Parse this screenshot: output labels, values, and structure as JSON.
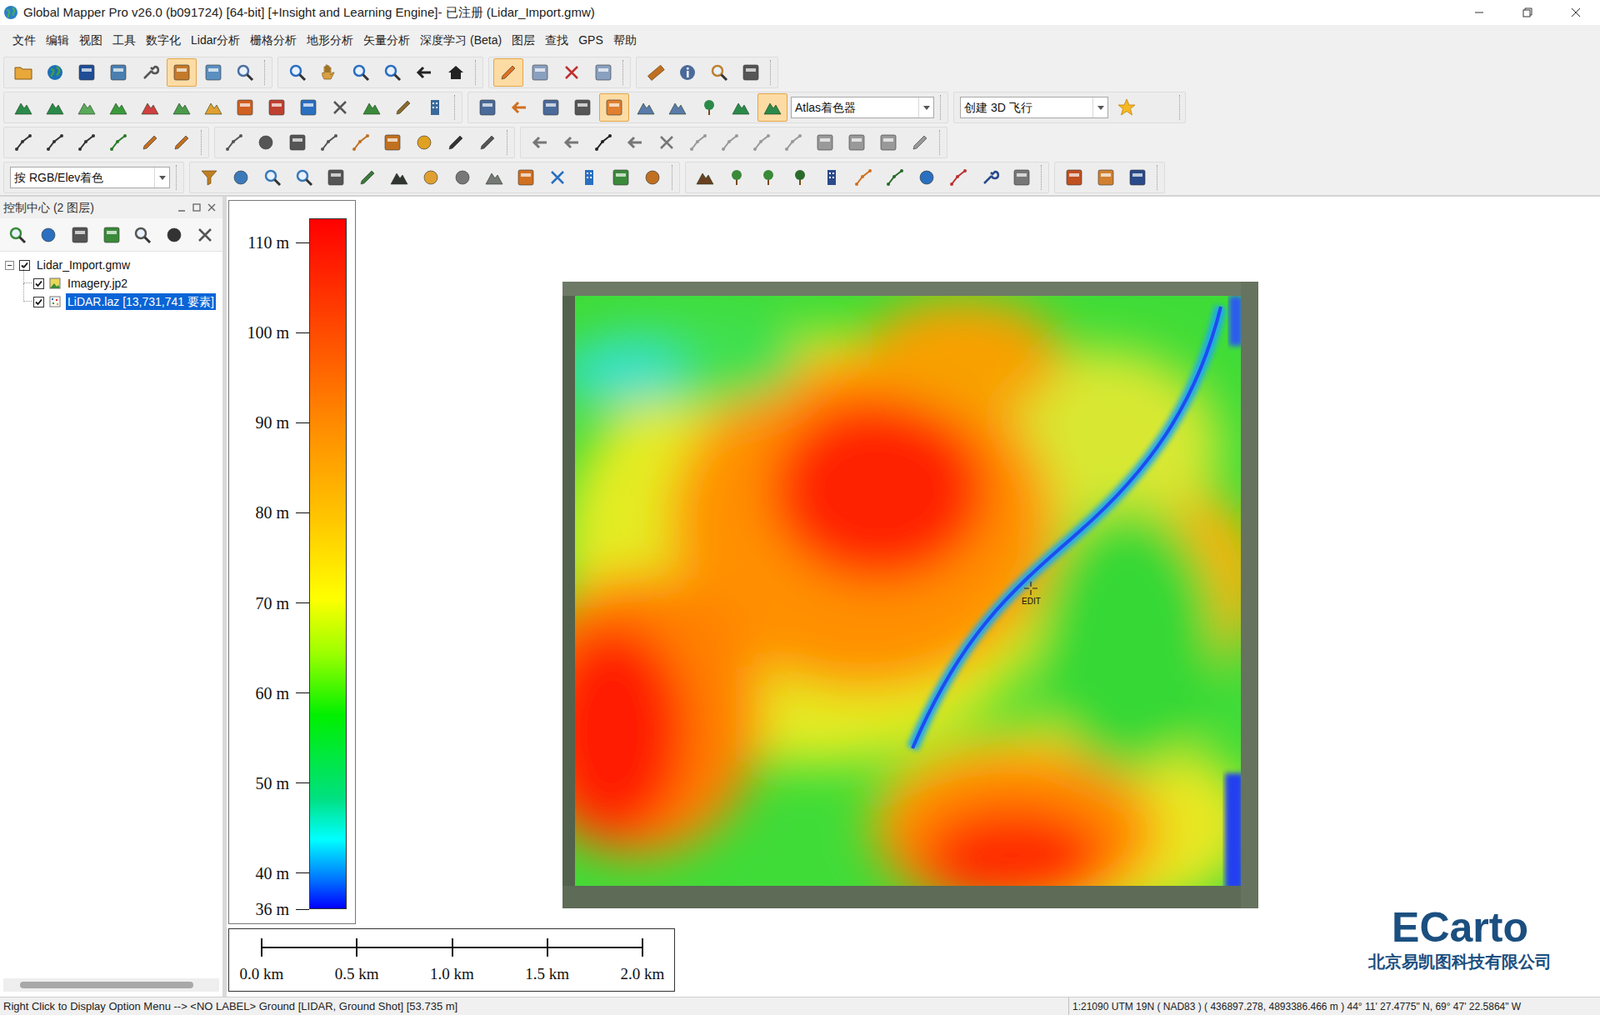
{
  "window": {
    "title": "Global Mapper Pro v26.0 (b091724) [64-bit] [+Insight and Learning Engine]- 已注册 (Lidar_Import.gmw)"
  },
  "menu": [
    "文件",
    "编辑",
    "视图",
    "工具",
    "数字化",
    "Lidar分析",
    "栅格分析",
    "地形分析",
    "矢量分析",
    "深度学习 (Beta)",
    "图层",
    "查找",
    "GPS",
    "帮助"
  ],
  "toolbars": [
    {
      "active": [
        5,
        14
      ]
    },
    {
      "active": [
        18,
        23
      ]
    },
    {
      "active": []
    },
    {
      "active": []
    }
  ],
  "dropdowns": {
    "shader": "Atlas着色器",
    "flythrough": "创建 3D 飞行",
    "color_mode": "按 RGB/Elev着色"
  },
  "control_center": {
    "title": "控制中心 (2 图层)",
    "layers": [
      {
        "label": "Lidar_Import.gmw",
        "kind": "workspace",
        "expanded": true,
        "checked": true,
        "selected": false
      },
      {
        "label": "Imagery.jp2",
        "kind": "raster",
        "expanded": false,
        "checked": true,
        "selected": false
      },
      {
        "label": "LiDAR.laz [13,731,741 要素]",
        "kind": "lidar",
        "expanded": false,
        "checked": true,
        "selected": true
      }
    ],
    "scrollbar": {
      "level": 0.8
    }
  },
  "legend": {
    "min": 36,
    "max": 112.7,
    "ticks": [
      {
        "label": "110 m",
        "value": 110
      },
      {
        "label": "100 m",
        "value": 100
      },
      {
        "label": "90 m",
        "value": 90
      },
      {
        "label": "80 m",
        "value": 80
      },
      {
        "label": "70 m",
        "value": 70
      },
      {
        "label": "60 m",
        "value": 60
      },
      {
        "label": "50 m",
        "value": 50
      },
      {
        "label": "40 m",
        "value": 40
      },
      {
        "label": "36 m",
        "value": 36
      }
    ]
  },
  "scale_bar": {
    "ticks": [
      "0.0 km",
      "0.5 km",
      "1.0 km",
      "1.5 km",
      "2.0 km"
    ]
  },
  "map": {
    "cursor_label": "EDIT"
  },
  "watermark": {
    "brand": "ECarto",
    "company": "北京易凯图科技有限公司"
  },
  "status_bar": {
    "left": "Right Click to Display Option Menu --> <NO LABEL> Ground [LIDAR, Ground Shot] [53.735 m]",
    "right": "1:21090 UTM 19N ( NAD83 ) ( 436897.278, 4893386.466 m ) 44° 11' 27.4775\" N, 69° 47' 22.5864\" W"
  }
}
